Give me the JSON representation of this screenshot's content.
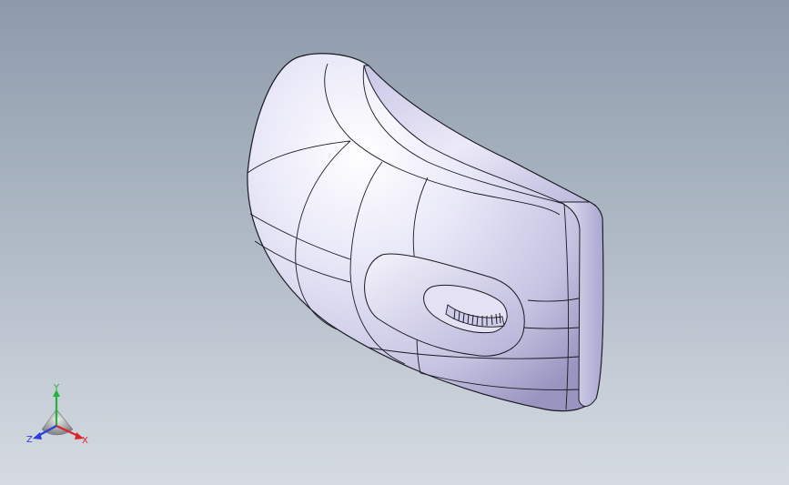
{
  "viewport": {
    "background_top": "#8e9aab",
    "background_bottom": "#d6dbe2"
  },
  "model": {
    "body_color": "#d8d6ef",
    "highlight_color": "#ffffff",
    "shadow_color": "#8d88b5",
    "edge_color": "#1a1a22"
  },
  "triad": {
    "x_label": "X",
    "y_label": "Y",
    "z_label": "Z",
    "x_color": "#d9262a",
    "y_color": "#22b33a",
    "z_color": "#2a3fd6"
  }
}
